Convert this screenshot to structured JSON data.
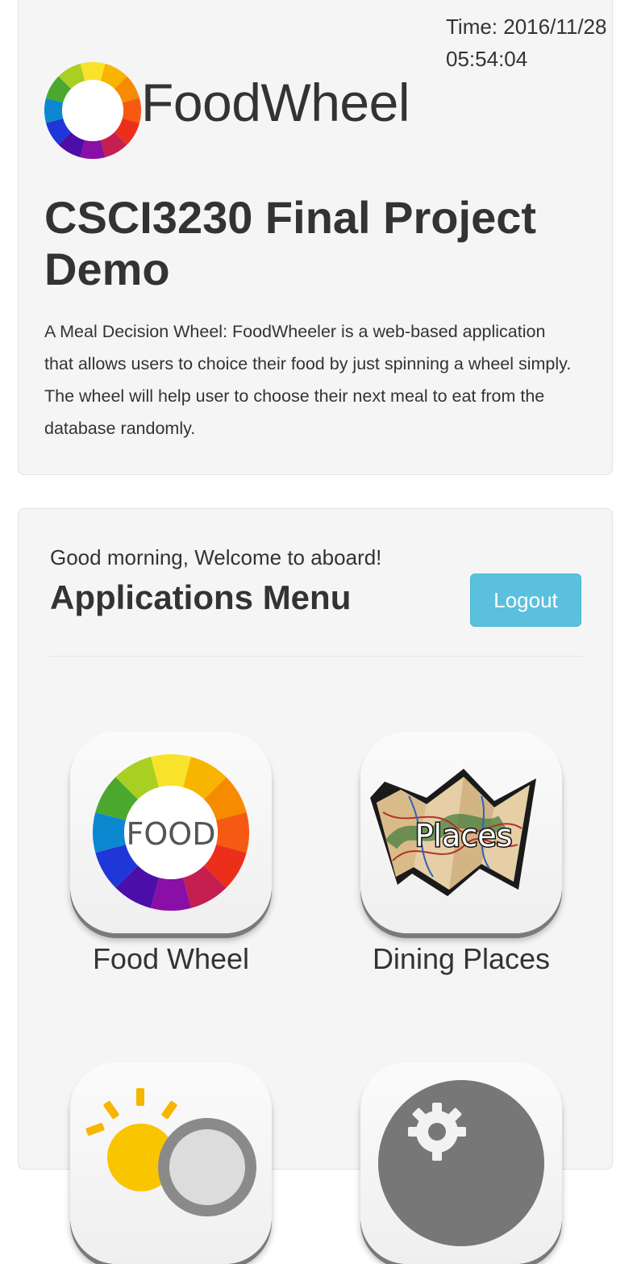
{
  "header": {
    "clock_label": "Time: 2016/11/28",
    "clock_time": "05:54:04",
    "brand_name": "FoodWheel",
    "project_title": "CSCI3230 Final Project Demo",
    "description": "A Meal Decision Wheel: FoodWheeler is a web-based application that allows users to choice their food by just spinning a wheel simply. The wheel will help user to choose their next meal to eat from the database randomly."
  },
  "menu": {
    "greeting": "Good morning, Welcome to aboard!",
    "title": "Applications Menu",
    "logout_label": "Logout",
    "apps": [
      {
        "label": "Food Wheel",
        "icon": "food-wheel-icon",
        "icon_text": "FOOD"
      },
      {
        "label": "Dining Places",
        "icon": "places-map-icon",
        "icon_text": "Places"
      },
      {
        "label": "",
        "icon": "weather-icon"
      },
      {
        "label": "",
        "icon": "settings-gear-icon"
      }
    ]
  },
  "colors": {
    "panel_bg": "#f5f5f5",
    "text": "#333333",
    "logout_button": "#5bc0de",
    "wheel": [
      "#f9e22a",
      "#f7b500",
      "#f78b00",
      "#f65a12",
      "#ec2f1b",
      "#c41f4f",
      "#8a0fa6",
      "#4b0ea8",
      "#1f37d8",
      "#0b88d0",
      "#4aa82f",
      "#a8cf22"
    ]
  }
}
